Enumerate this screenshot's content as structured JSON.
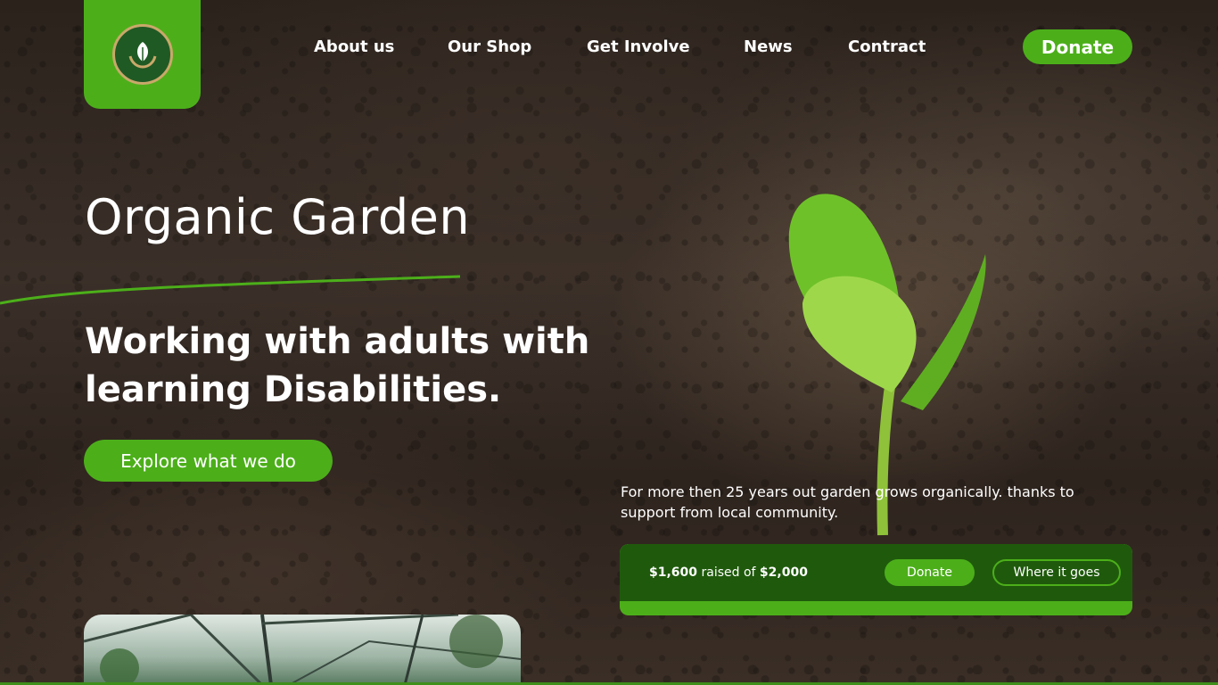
{
  "nav": {
    "items": [
      {
        "label": "About us"
      },
      {
        "label": "Our Shop"
      },
      {
        "label": "Get Involve"
      },
      {
        "label": "News"
      },
      {
        "label": "Contract"
      }
    ],
    "donate_label": "Donate"
  },
  "hero": {
    "title": "Organic Garden",
    "subtitle": "Working with adults with learning Disabilities.",
    "cta_label": "Explore what we do",
    "blurb": "For more then 25 years out garden grows organically. thanks to support from local community."
  },
  "fundraiser": {
    "raised": "$1,600",
    "raised_text": " raised of ",
    "goal": "$2,000",
    "progress": 0.8,
    "donate_label": "Donate",
    "where_label": "Where it goes"
  },
  "colors": {
    "accent": "#4caf1a",
    "panel_dark": "#1f5a0c"
  },
  "icons": {
    "logo": "leaf-hands-logo-icon"
  }
}
